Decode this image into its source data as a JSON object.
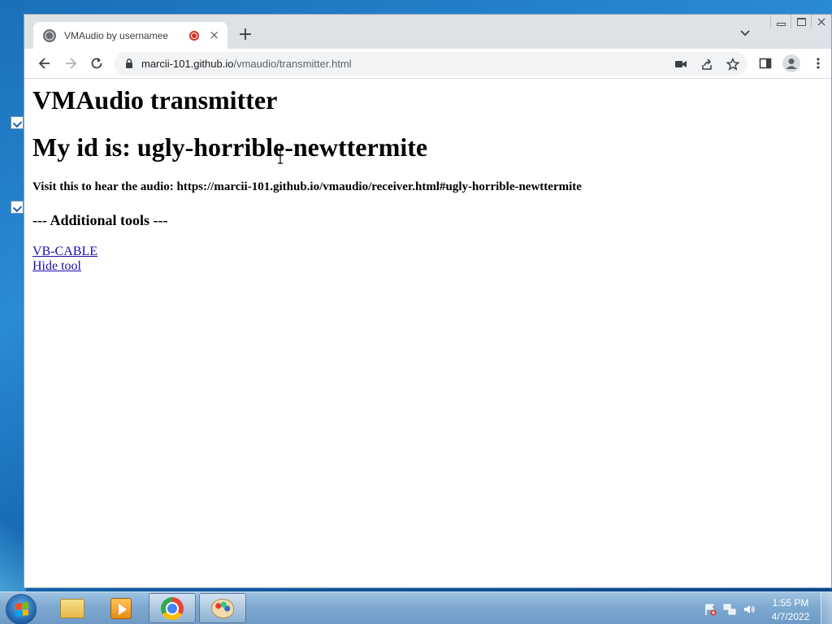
{
  "browser": {
    "tab": {
      "title": "VMAudio by usernamee",
      "close_label": "×"
    },
    "new_tab_label": "+",
    "url": {
      "host": "marcii-101.github.io",
      "path": "/vmaudio/transmitter.html"
    }
  },
  "page": {
    "title": "VMAudio transmitter",
    "id_heading": "My id is: ugly-horrible-newttermite",
    "visit_text": "Visit this to hear the audio: https://marcii-101.github.io/vmaudio/receiver.html#ugly-horrible-newttermite",
    "tools_heading": "--- Additional tools ---",
    "links": [
      {
        "label": "VB-CABLE"
      },
      {
        "label": "Hide tool"
      }
    ]
  },
  "taskbar": {
    "items": [
      "folder-icon",
      "media-player-icon",
      "chrome-icon",
      "paint-icon"
    ],
    "clock_time": "1:55 PM",
    "clock_date": "4/7/2022"
  },
  "colors": {
    "link": "#1a0dab",
    "recording": "#d93025",
    "tabbar": "#dee1e6",
    "omnibox": "#f1f3f4"
  }
}
